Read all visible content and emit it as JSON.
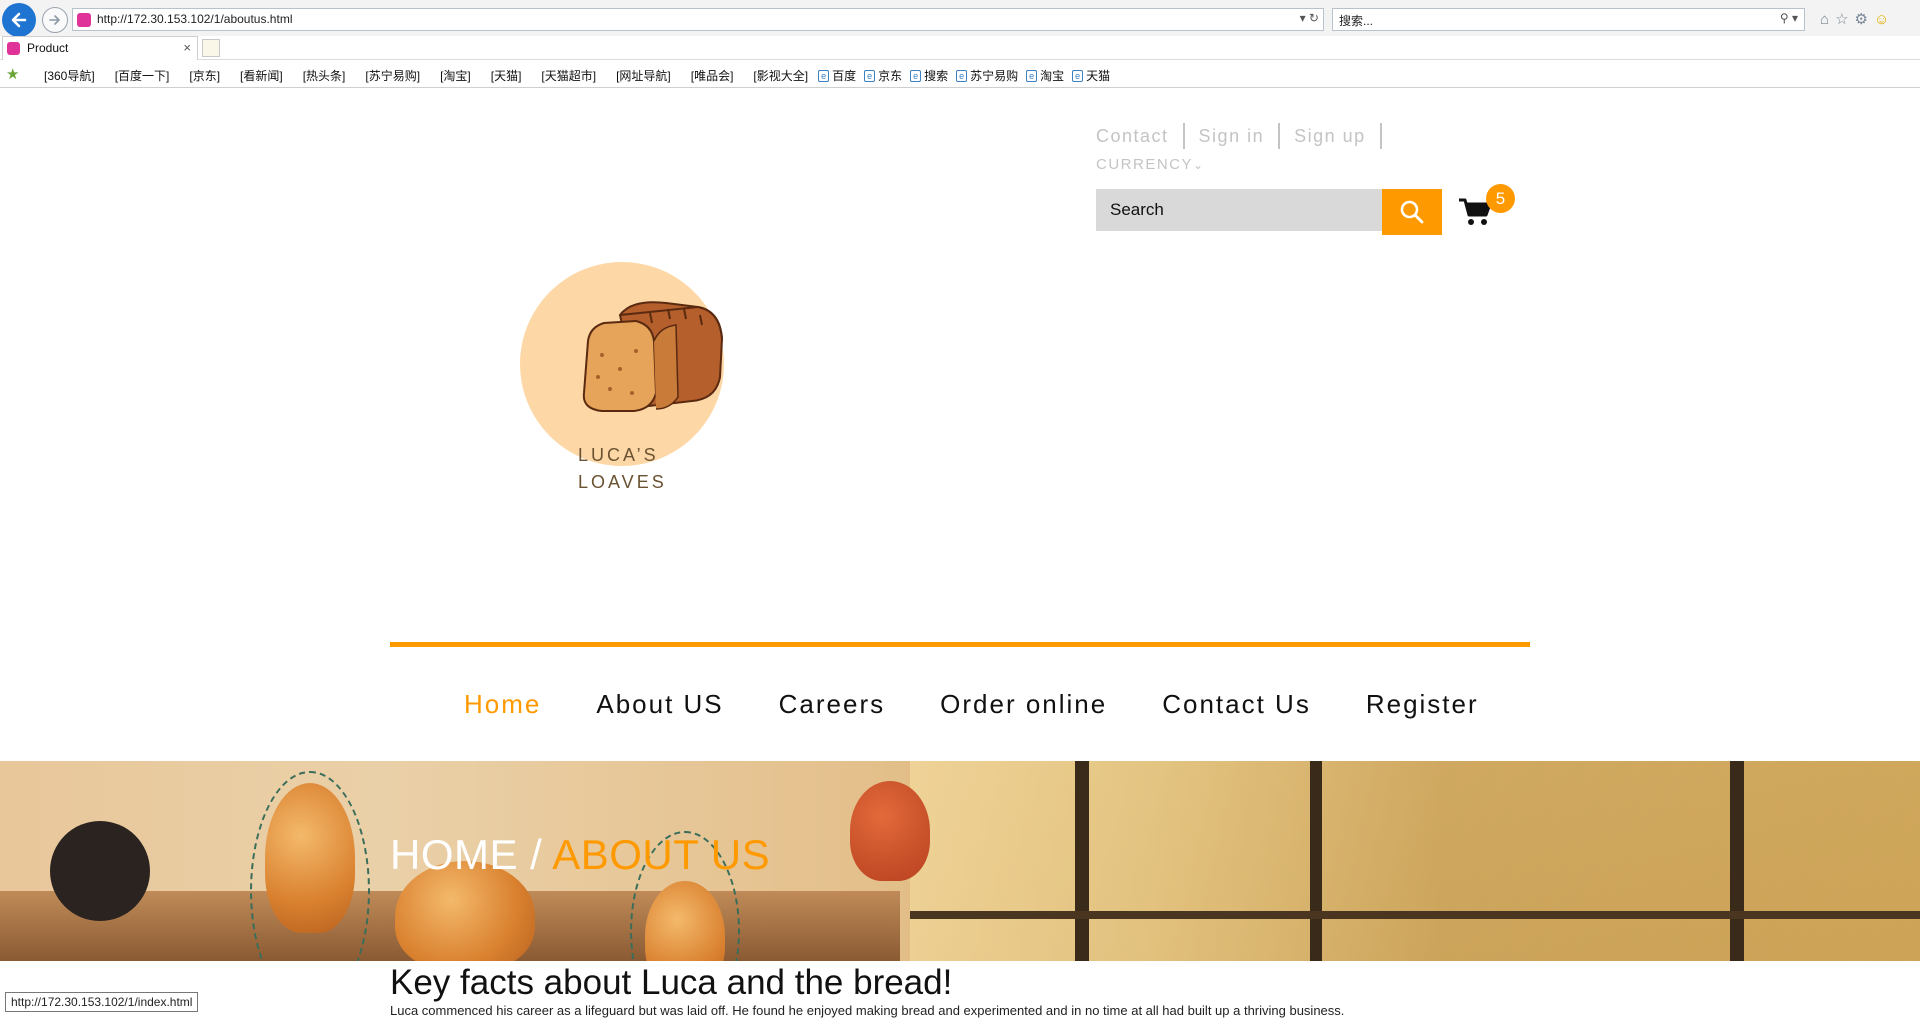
{
  "browser": {
    "url": "http://172.30.153.102/1/aboutus.html",
    "search_placeholder": "搜索...",
    "tab_title": "Product",
    "tab_close": "×",
    "favorites": [
      "[360导航]",
      "[百度一下]",
      "[京东]",
      "[看新闻]",
      "[热头条]",
      "[苏宁易购]",
      "[淘宝]",
      "[天猫]",
      "[天猫超市]",
      "[网址导航]",
      "[唯品会]",
      "[影视大全]"
    ],
    "favorite_links": [
      "百度",
      "京东",
      "搜索",
      "苏宁易购",
      "淘宝",
      "天猫"
    ],
    "status_url": "http://172.30.153.102/1/index.html"
  },
  "header": {
    "links": [
      "Contact",
      "Sign in",
      "Sign up"
    ],
    "currency": "CURRENCY",
    "currency_chevron": "⌄",
    "search_placeholder": "Search",
    "cart_count": "5"
  },
  "logo": {
    "line1": "LUCA’S",
    "line2": "LOAVES"
  },
  "nav": {
    "items": [
      "Home",
      "About US",
      "Careers",
      "Order online",
      "Contact Us",
      "Register"
    ],
    "active_index": 0
  },
  "banner": {
    "crumb_home": "HOME /",
    "crumb_current": "ABOUT US"
  },
  "content": {
    "title": "Key facts about Luca and the bread!",
    "body": "Luca commenced his career as a lifeguard but was laid off. He found he enjoyed making bread and experimented and in no time at all had built up a thriving business."
  },
  "colors": {
    "accent": "#ff9900",
    "logo_circle": "#fdd8a6",
    "search_bg": "#d9d9d9",
    "muted_link": "#c4c4c4"
  }
}
